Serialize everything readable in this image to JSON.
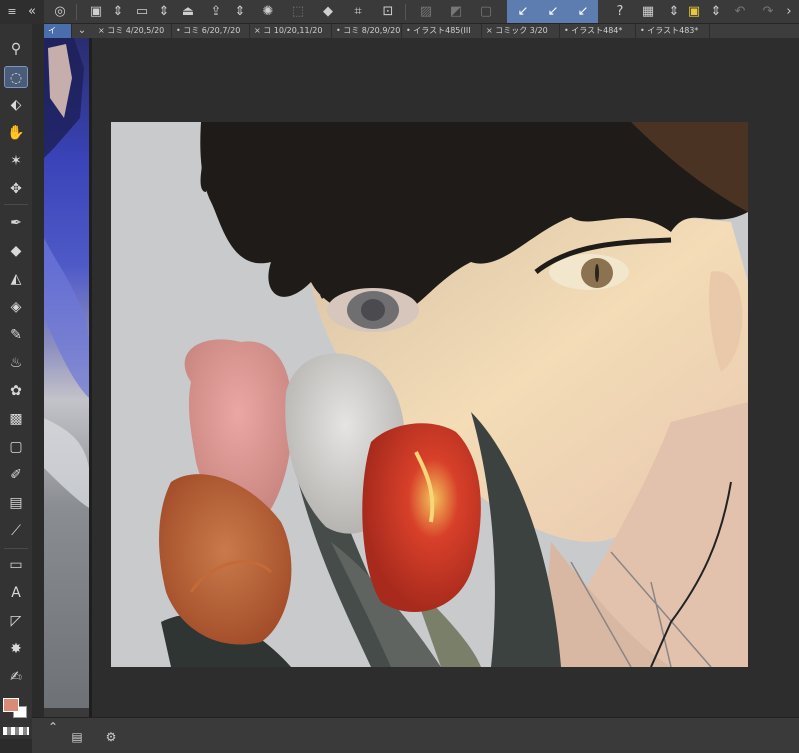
{
  "tabs": [
    {
      "label": "イ"
    },
    {
      "label": "コミ 4/20,5/20"
    },
    {
      "label": "コミ 6/20,7/20"
    },
    {
      "label": "コ 10/20,11/20"
    },
    {
      "label": "コミ 8/20,9/20"
    },
    {
      "label": "イラスト485(III"
    },
    {
      "label": "コミック 3/20"
    },
    {
      "label": "イラスト484*"
    },
    {
      "label": "イラスト483*"
    }
  ],
  "icons": {
    "menu": "≡",
    "back": "«",
    "logo": "◎",
    "new": "▣",
    "open": "▭",
    "save_cloud": "⏏",
    "export": "⇪",
    "loading": "✺",
    "transform": "⬚",
    "fill": "◆",
    "crop": "⌗",
    "crop2": "⊡",
    "brush1": "↙",
    "brush2": "↙",
    "brush3": "↙",
    "help": "?",
    "image": "▦",
    "layer_color": "▣",
    "undo": "↶",
    "redo": "↷",
    "more": "›",
    "updown": "⇕",
    "bottom_up": "⌃",
    "bottom_panel": "▤",
    "bottom_settings": "⚙"
  },
  "tools": {
    "zoom": "⚲",
    "lasso": "◌",
    "select_object": "⬖",
    "hand": "✋",
    "wand": "✶",
    "move": "✥",
    "pen": "✒",
    "eraser": "◆",
    "fill": "◭",
    "blend": "◈",
    "pencil": "✎",
    "airbrush": "♨",
    "decoration": "✿",
    "pattern": "▩",
    "shape": "▢",
    "vector": "✐",
    "gradient": "▤",
    "eyedropper": "⟋",
    "ruler": "▭",
    "text": "A",
    "frame": "◸",
    "spray": "✸",
    "brush": "✍"
  },
  "colors": {
    "main": "#d98b77",
    "sub": "#ffffff",
    "accent": "#5d7db0"
  }
}
